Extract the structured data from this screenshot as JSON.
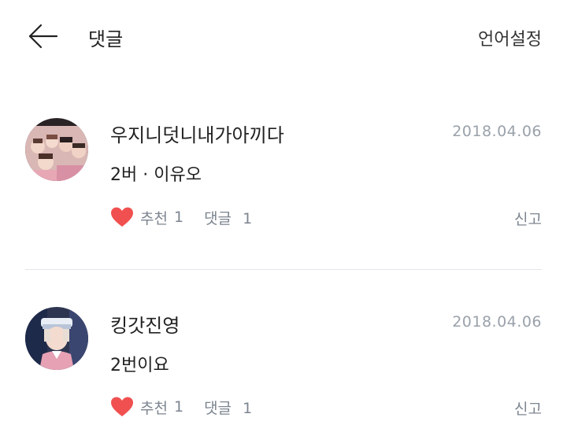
{
  "header": {
    "title": "댓글",
    "language_setting": "언어설정"
  },
  "comments": [
    {
      "author": "우지니덧니내가아끼다",
      "date": "2018.04.06",
      "body": "2버 · 이유오",
      "like_label": "추천",
      "like_count": "1",
      "reply_label": "댓글",
      "reply_count": "1",
      "report_label": "신고"
    },
    {
      "author": "킹갓진영",
      "date": "2018.04.06",
      "body": "2번이요",
      "like_label": "추천",
      "like_count": "1",
      "reply_label": "댓글",
      "reply_count": "1",
      "report_label": "신고"
    }
  ],
  "colors": {
    "heart": "#f0504f",
    "date": "#9aa1aa",
    "meta": "#7d8590",
    "divider": "#e3e6ea"
  }
}
